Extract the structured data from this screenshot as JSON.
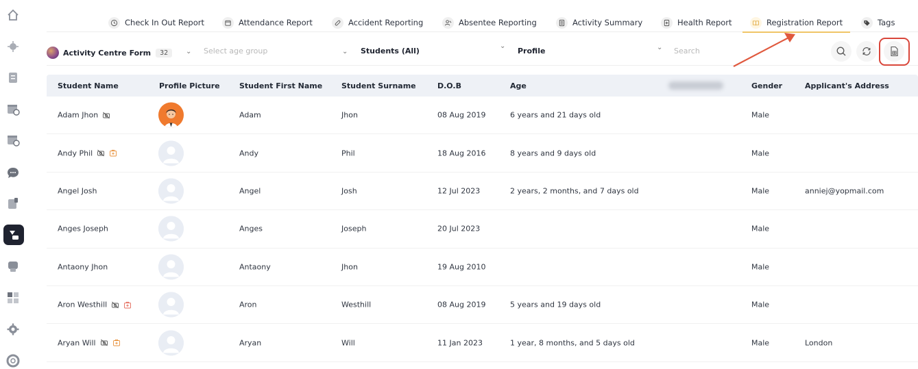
{
  "tabs": [
    {
      "label": "Check In Out Report",
      "icon": "clock-icon"
    },
    {
      "label": "Attendance Report",
      "icon": "calendar-icon"
    },
    {
      "label": "Accident Reporting",
      "icon": "bandage-icon"
    },
    {
      "label": "Absentee Reporting",
      "icon": "user-absent-icon"
    },
    {
      "label": "Activity Summary",
      "icon": "list-icon"
    },
    {
      "label": "Health Report",
      "icon": "health-icon"
    },
    {
      "label": "Registration Report",
      "icon": "book-icon",
      "active": true
    },
    {
      "label": "Tags",
      "icon": "tag-icon"
    }
  ],
  "filters": {
    "form_name": "Activity Centre Form",
    "form_count": "32",
    "age_group_placeholder": "Select age group",
    "students_value": "Students (All)",
    "profile_value": "Profile",
    "search_placeholder": "Search"
  },
  "table": {
    "columns": [
      "Student Name",
      "Profile Picture",
      "Student First Name",
      "Student Surname",
      "D.O.B",
      "Age",
      "Gender",
      "Applicant's Address"
    ],
    "rows": [
      {
        "name": "Adam Jhon",
        "first": "Adam",
        "surname": "Jhon",
        "dob": "08 Aug 2019",
        "age": "6 years and 21 days old",
        "gender": "Male",
        "address": "",
        "has_photo": true,
        "no_photo_flag": true,
        "medical_flag": false
      },
      {
        "name": "Andy Phil",
        "first": "Andy",
        "surname": "Phil",
        "dob": "18 Aug 2016",
        "age": "8 years and 9 days old",
        "gender": "Male",
        "address": "",
        "has_photo": false,
        "no_photo_flag": true,
        "medical_flag": true
      },
      {
        "name": "Angel Josh",
        "first": "Angel",
        "surname": "Josh",
        "dob": "12 Jul 2023",
        "age": "2 years, 2 months, and 7 days old",
        "gender": "Male",
        "address": "anniej@yopmail.com",
        "has_photo": false,
        "no_photo_flag": false,
        "medical_flag": false
      },
      {
        "name": "Anges Joseph",
        "first": "Anges",
        "surname": "Joseph",
        "dob": "20 Jul 2023",
        "age": "",
        "gender": "Male",
        "address": "",
        "has_photo": false,
        "no_photo_flag": false,
        "medical_flag": false
      },
      {
        "name": "Antaony Jhon",
        "first": "Antaony",
        "surname": "Jhon",
        "dob": "19 Aug 2010",
        "age": "",
        "gender": "Male",
        "address": "",
        "has_photo": false,
        "no_photo_flag": false,
        "medical_flag": false
      },
      {
        "name": "Aron Westhill",
        "first": "Aron",
        "surname": "Westhill",
        "dob": "08 Aug 2019",
        "age": "5 years and 19 days old",
        "gender": "Male",
        "address": "",
        "has_photo": false,
        "no_photo_flag": true,
        "medical_flag": true
      },
      {
        "name": "Aryan Will",
        "first": "Aryan",
        "surname": "Will",
        "dob": "11 Jan 2023",
        "age": "1 year, 8 months, and 5 days old",
        "gender": "Male",
        "address": "London",
        "has_photo": false,
        "no_photo_flag": true,
        "medical_flag": true
      }
    ]
  },
  "colors": {
    "active_tab_underline": "#f0c566",
    "annotation": "#d9463a",
    "header_bg": "#eef1f6"
  }
}
